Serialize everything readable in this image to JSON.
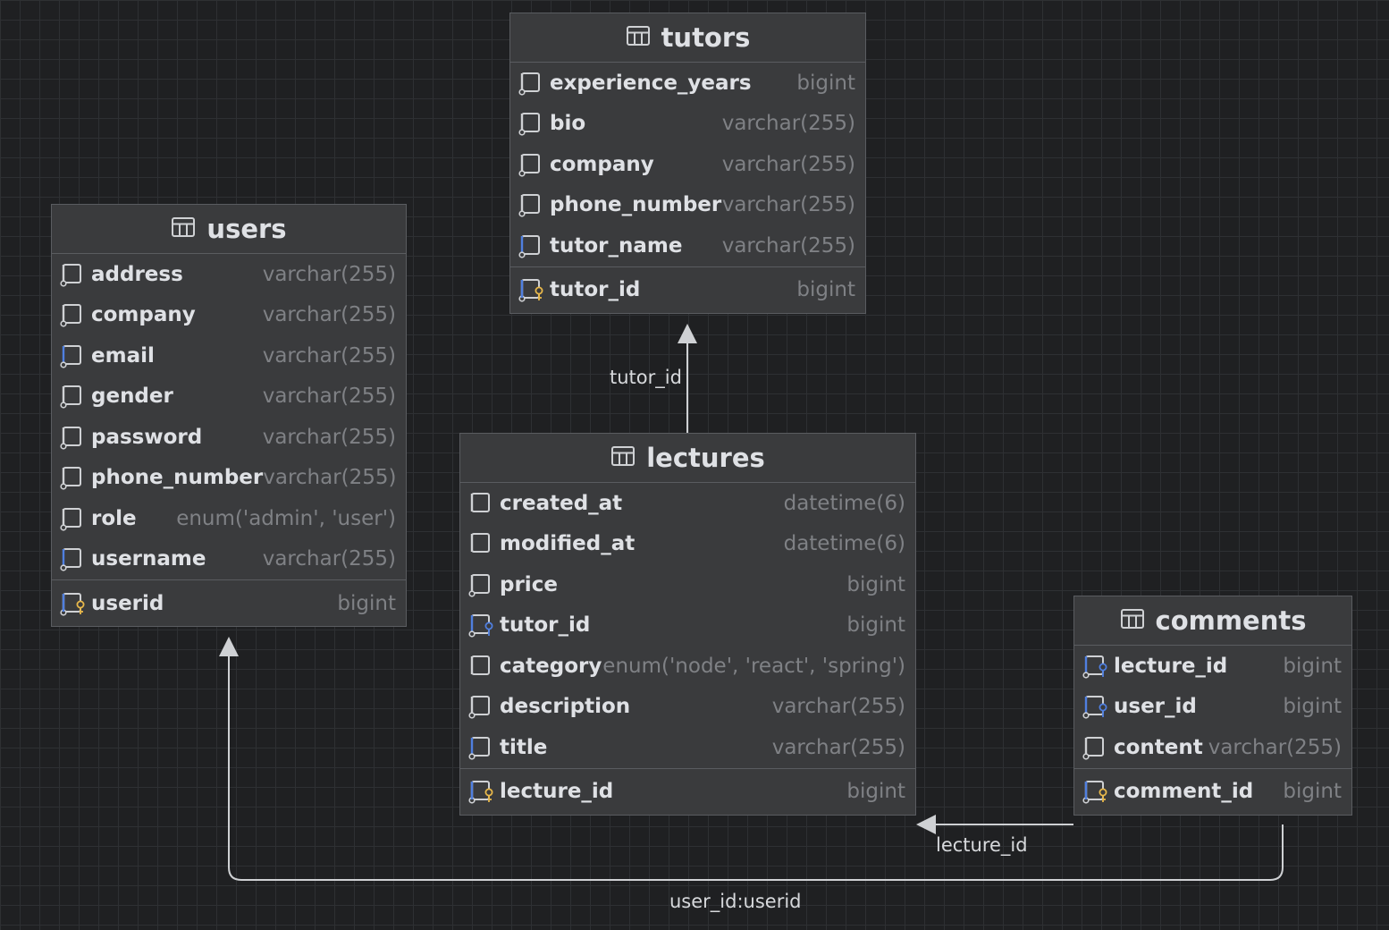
{
  "tables": {
    "tutors": {
      "name": "tutors",
      "columns": [
        {
          "name": "experience_years",
          "type": "bigint",
          "icon": "column-icon"
        },
        {
          "name": "bio",
          "type": "varchar(255)",
          "icon": "column-icon"
        },
        {
          "name": "company",
          "type": "varchar(255)",
          "icon": "column-icon"
        },
        {
          "name": "phone_number",
          "type": "varchar(255)",
          "icon": "column-icon"
        },
        {
          "name": "tutor_name",
          "type": "varchar(255)",
          "icon": "column-index-icon"
        }
      ],
      "pk": {
        "name": "tutor_id",
        "type": "bigint",
        "icon": "primary-key-icon"
      }
    },
    "users": {
      "name": "users",
      "columns": [
        {
          "name": "address",
          "type": "varchar(255)",
          "icon": "column-icon"
        },
        {
          "name": "company",
          "type": "varchar(255)",
          "icon": "column-icon"
        },
        {
          "name": "email",
          "type": "varchar(255)",
          "icon": "column-index-icon"
        },
        {
          "name": "gender",
          "type": "varchar(255)",
          "icon": "column-icon"
        },
        {
          "name": "password",
          "type": "varchar(255)",
          "icon": "column-icon"
        },
        {
          "name": "phone_number",
          "type": "varchar(255)",
          "icon": "column-icon"
        },
        {
          "name": "role",
          "type": "enum('admin', 'user')",
          "icon": "column-icon"
        },
        {
          "name": "username",
          "type": "varchar(255)",
          "icon": "column-index-icon"
        }
      ],
      "pk": {
        "name": "userid",
        "type": "bigint",
        "icon": "primary-key-icon"
      }
    },
    "lectures": {
      "name": "lectures",
      "columns": [
        {
          "name": "created_at",
          "type": "datetime(6)",
          "icon": "column-notnull-icon"
        },
        {
          "name": "modified_at",
          "type": "datetime(6)",
          "icon": "column-notnull-icon"
        },
        {
          "name": "price",
          "type": "bigint",
          "icon": "column-icon"
        },
        {
          "name": "tutor_id",
          "type": "bigint",
          "icon": "foreign-key-icon"
        },
        {
          "name": "category",
          "type": "enum('node', 'react', 'spring')",
          "icon": "column-notnull-icon"
        },
        {
          "name": "description",
          "type": "varchar(255)",
          "icon": "column-icon"
        },
        {
          "name": "title",
          "type": "varchar(255)",
          "icon": "column-index-icon"
        }
      ],
      "pk": {
        "name": "lecture_id",
        "type": "bigint",
        "icon": "primary-key-icon"
      }
    },
    "comments": {
      "name": "comments",
      "columns": [
        {
          "name": "lecture_id",
          "type": "bigint",
          "icon": "foreign-key-icon"
        },
        {
          "name": "user_id",
          "type": "bigint",
          "icon": "foreign-key-icon"
        },
        {
          "name": "content",
          "type": "varchar(255)",
          "icon": "column-icon"
        }
      ],
      "pk": {
        "name": "comment_id",
        "type": "bigint",
        "icon": "primary-key-icon"
      }
    }
  },
  "relations": [
    {
      "from": "lectures",
      "to": "tutors",
      "label": "tutor_id"
    },
    {
      "from": "comments",
      "to": "lectures",
      "label": "lecture_id"
    },
    {
      "from": "comments",
      "to": "users",
      "label": "user_id:userid"
    }
  ],
  "colors": {
    "background": "#1f2022",
    "grid": "#2e3033",
    "table_fill": "#3a3b3d",
    "table_border": "#5a5c60",
    "column_name": "#dfe1e5",
    "column_type": "#7f8185",
    "index_accent": "#4f7fe0",
    "key_accent": "#e8b84a",
    "connector": "#cfd1d4"
  }
}
